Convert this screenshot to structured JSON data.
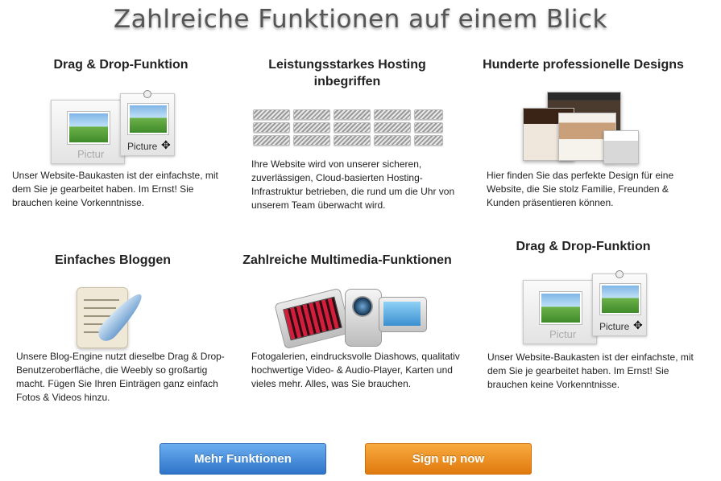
{
  "page": {
    "title": "Zahlreiche Funktionen auf einem Blick"
  },
  "features": [
    {
      "title": "Drag & Drop-Funktion",
      "text": "Unser Website-Baukasten ist der einfachste, mit dem Sie je gearbeitet haben. Im Ernst! Sie brauchen keine Vorkenntnisse.",
      "illustration": "picture-frames-icon",
      "labels": {
        "front": "Picture",
        "back": "Pictur"
      }
    },
    {
      "title": "Leistungsstarkes Hosting inbegriffen",
      "text": "Ihre Website wird von unserer sicheren, zuverlässigen, Cloud-basierten Hosting-Infrastruktur betrieben, die rund um die Uhr von unserem Team überwacht wird.",
      "illustration": "server-rack-icon"
    },
    {
      "title": "Hunderte professionelle Designs",
      "text": "Hier finden Sie das perfekte Design für eine Website, die Sie stolz Familie, Freunden & Kunden präsentieren können.",
      "illustration": "design-collage-icon"
    },
    {
      "title": "Einfaches Bloggen",
      "text": "Unsere Blog-Engine nutzt dieselbe Drag & Drop-Benutzeroberfläche, die Weebly so großartig macht. Fügen Sie Ihren Einträgen ganz einfach Fotos & Videos hinzu.",
      "illustration": "quill-paper-icon"
    },
    {
      "title": "Zahlreiche Multimedia-Funktionen",
      "text": "Fotogalerien, eindrucksvolle Diashows, qualitativ hochwertige Video- & Audio-Player, Karten und vieles mehr. Alles, was Sie brauchen.",
      "illustration": "multimedia-devices-icon"
    },
    {
      "title": "Drag & Drop-Funktion",
      "text": "Unser Website-Baukasten ist der einfachste, mit dem Sie je gearbeitet haben. Im Ernst! Sie brauchen keine Vorkenntnisse.",
      "illustration": "picture-frames-icon",
      "labels": {
        "front": "Picture",
        "back": "Pictur"
      }
    }
  ],
  "buttons": {
    "more": "Mehr Funktionen",
    "signup": "Sign up now"
  },
  "colors": {
    "primary_button": "#3b82d6",
    "cta_button": "#ef8c1f"
  }
}
